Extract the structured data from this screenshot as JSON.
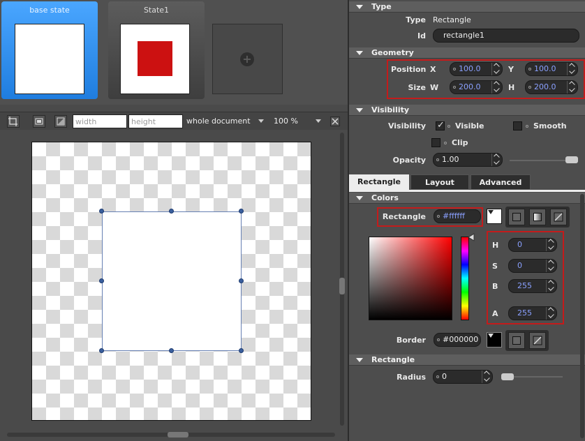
{
  "states": {
    "base_label": "base state",
    "state1_label": "State1"
  },
  "toolbar": {
    "width_placeholder": "width",
    "height_placeholder": "height",
    "scope": "whole document",
    "zoom": "100 %"
  },
  "props": {
    "type_section": "Type",
    "type_label": "Type",
    "type_value": "Rectangle",
    "id_label": "Id",
    "id_value": "rectangle1",
    "geometry_section": "Geometry",
    "position_label": "Position",
    "size_label": "Size",
    "x_label": "X",
    "x_value": "100.0",
    "y_label": "Y",
    "y_value": "100.0",
    "w_label": "W",
    "w_value": "200.0",
    "h_label": "H",
    "h_value": "200.0",
    "visibility_section": "Visibility",
    "visibility_label": "Visibility",
    "visible_label": "Visible",
    "smooth_label": "Smooth",
    "clip_label": "Clip",
    "visible_checked": true,
    "smooth_checked": false,
    "clip_checked": false,
    "opacity_label": "Opacity",
    "opacity_value": "1.00",
    "tabs": [
      "Rectangle",
      "Layout",
      "Advanced"
    ],
    "colors_section": "Colors",
    "rect_color_label": "Rectangle",
    "rect_color_value": "#ffffff",
    "hsba": {
      "h_label": "H",
      "h": "0",
      "s_label": "S",
      "s": "0",
      "b_label": "B",
      "b": "255",
      "a_label": "A",
      "a": "255"
    },
    "border_label": "Border",
    "border_value": "#000000",
    "rect_section": "Rectangle",
    "radius_label": "Radius",
    "radius_value": "0"
  },
  "colors": {
    "accent_blue": "#2a8ef0",
    "rect_fill": "#ffffff",
    "state1_fill": "#cc1111",
    "highlight_red": "#c41b1b"
  }
}
